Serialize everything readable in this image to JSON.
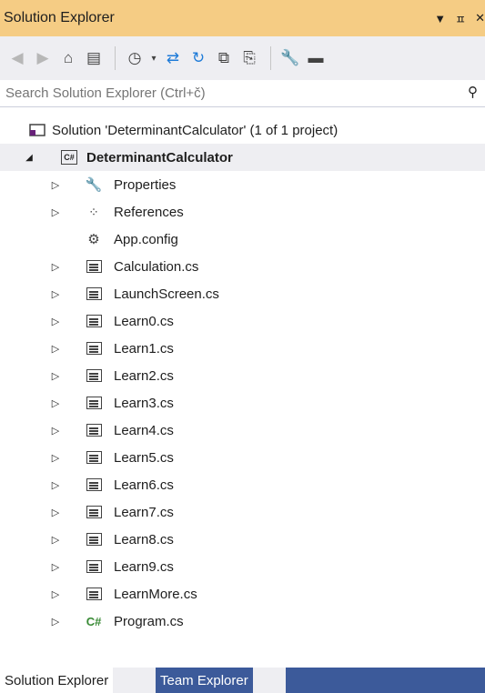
{
  "window": {
    "title": "Solution Explorer",
    "pin_icon": "pin-icon",
    "close_icon": "close-icon",
    "dropdown_icon": "chevron-down-icon"
  },
  "toolbar": {
    "buttons": [
      "back-icon",
      "forward-icon",
      "home-icon",
      "switch-views-icon",
      "pending-changes-icon",
      "sync-icon",
      "refresh-icon",
      "collapse-all-icon",
      "show-all-files-icon",
      "properties-icon",
      "preview-icon"
    ]
  },
  "search": {
    "placeholder": "Search Solution Explorer (Ctrl+č)"
  },
  "tree": {
    "solution": "Solution 'DeterminantCalculator' (1 of 1 project)",
    "project": "DeterminantCalculator",
    "items": [
      {
        "label": "Properties",
        "icon": "wrench-icon",
        "expandable": true
      },
      {
        "label": "References",
        "icon": "references-icon",
        "expandable": true
      },
      {
        "label": "App.config",
        "icon": "config-icon",
        "expandable": false
      },
      {
        "label": "Calculation.cs",
        "icon": "form-icon",
        "expandable": true
      },
      {
        "label": "LaunchScreen.cs",
        "icon": "form-icon",
        "expandable": true
      },
      {
        "label": "Learn0.cs",
        "icon": "form-icon",
        "expandable": true
      },
      {
        "label": "Learn1.cs",
        "icon": "form-icon",
        "expandable": true
      },
      {
        "label": "Learn2.cs",
        "icon": "form-icon",
        "expandable": true
      },
      {
        "label": "Learn3.cs",
        "icon": "form-icon",
        "expandable": true
      },
      {
        "label": "Learn4.cs",
        "icon": "form-icon",
        "expandable": true
      },
      {
        "label": "Learn5.cs",
        "icon": "form-icon",
        "expandable": true
      },
      {
        "label": "Learn6.cs",
        "icon": "form-icon",
        "expandable": true
      },
      {
        "label": "Learn7.cs",
        "icon": "form-icon",
        "expandable": true
      },
      {
        "label": "Learn8.cs",
        "icon": "form-icon",
        "expandable": true
      },
      {
        "label": "Learn9.cs",
        "icon": "form-icon",
        "expandable": true
      },
      {
        "label": "LearnMore.cs",
        "icon": "form-icon",
        "expandable": true
      },
      {
        "label": "Program.cs",
        "icon": "csharp-file-icon",
        "expandable": true
      }
    ]
  },
  "bottom_tabs": {
    "active": "Solution Explorer",
    "inactive": "Team Explorer"
  },
  "colors": {
    "title_bar": "#f5cc84",
    "toolbar": "#eeeef2",
    "inactive_tab": "#3c5a9a"
  }
}
